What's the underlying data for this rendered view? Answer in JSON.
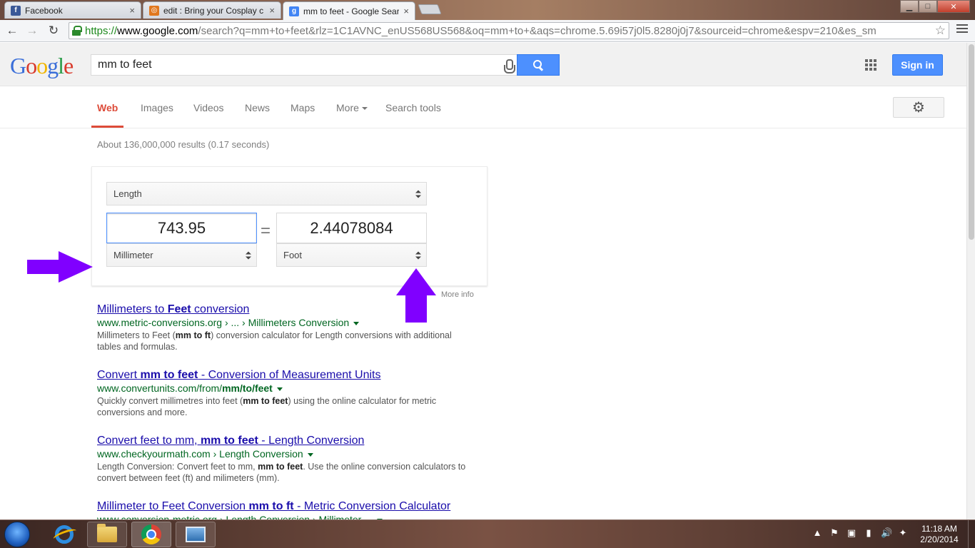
{
  "browser": {
    "tabs": [
      {
        "title": "Facebook",
        "close": "×",
        "favicon_color": "#3b5998",
        "favicon_glyph": "f"
      },
      {
        "title": "edit : Bring your Cosplay c",
        "close": "×",
        "favicon_color": "#e0771e",
        "favicon_glyph": "◎"
      },
      {
        "title": "mm to feet - Google Searc",
        "close": "×",
        "favicon_color": "#4285f4",
        "favicon_glyph": "g"
      }
    ],
    "window_controls": {
      "minimize": "▁",
      "maximize": "□",
      "close": "✕"
    },
    "nav": {
      "back": "←",
      "forward": "→",
      "reload": "↻"
    },
    "url": {
      "scheme": "https://",
      "host": "www.google.com",
      "path": "/search?q=mm+to+feet&rlz=1C1AVNC_enUS568US568&oq=mm+to+&aqs=chrome.5.69i57j0l5.8280j0j7&sourceid=chrome&espv=210&es_sm"
    },
    "bookmark_star": "☆"
  },
  "google": {
    "logo": {
      "l1": "G",
      "l2": "o",
      "l3": "o",
      "l4": "g",
      "l5": "l",
      "l6": "e"
    },
    "query": "mm to feet",
    "signin_label": "Sign in",
    "nav_tabs": [
      {
        "label": "Web"
      },
      {
        "label": "Images"
      },
      {
        "label": "Videos"
      },
      {
        "label": "News"
      },
      {
        "label": "Maps"
      },
      {
        "label": "More"
      },
      {
        "label": "Search tools"
      }
    ],
    "settings_icon": "⚙",
    "stats": "About 136,000,000 results (0.17 seconds)"
  },
  "converter": {
    "quantity": "Length",
    "from_value": "743.95",
    "to_value": "2.44078084",
    "equals": "=",
    "from_unit": "Millimeter",
    "to_unit": "Foot",
    "more_info": "More info"
  },
  "results": [
    {
      "title_a": "Millimeters to ",
      "title_b": "Feet",
      "title_c": " conversion",
      "url_a": "www.metric-conversions.org › ... › Millimeters Conversion",
      "url_b": "",
      "snip_a": "Millimeters to Feet (",
      "snip_b": "mm to ft",
      "snip_c": ") conversion calculator for Length conversions with additional tables and formulas."
    },
    {
      "title_a": "Convert ",
      "title_b": "mm to feet",
      "title_c": " - Conversion of Measurement Units",
      "url_a": "www.convertunits.com/from/",
      "url_b": "mm/to/feet",
      "snip_a": "Quickly convert millimetres into feet (",
      "snip_b": "mm to feet",
      "snip_c": ") using the online calculator for metric conversions and more."
    },
    {
      "title_a": "Convert feet to mm, ",
      "title_b": "mm to feet",
      "title_c": " - Length Conversion",
      "url_a": "www.checkyourmath.com › Length Conversion",
      "url_b": "",
      "snip_a": "Length Conversion: Convert feet to mm, ",
      "snip_b": "mm to feet",
      "snip_c": ". Use the online conversion calculators to convert between feet (ft) and milimeters (mm)."
    },
    {
      "title_a": "Millimeter to Feet Conversion ",
      "title_b": "mm to ft",
      "title_c": " - Metric Conversion Calculator",
      "url_a": "www.conversion-metric.org › Length Conversion › Millimeter ...",
      "url_b": "",
      "snip_a": "",
      "snip_b": "",
      "snip_c": ""
    }
  ],
  "taskbar": {
    "tray_icons": [
      "▲",
      "⚑",
      "▣",
      "▮",
      "🔊",
      "✦"
    ],
    "time": "11:18 AM",
    "date": "2/20/2014"
  },
  "colors": {
    "annotation_arrow": "#8000ff",
    "google_blue": "#4d90fe",
    "active_tab_red": "#dd4b39",
    "link_blue": "#1a0dab",
    "url_green": "#006621"
  }
}
